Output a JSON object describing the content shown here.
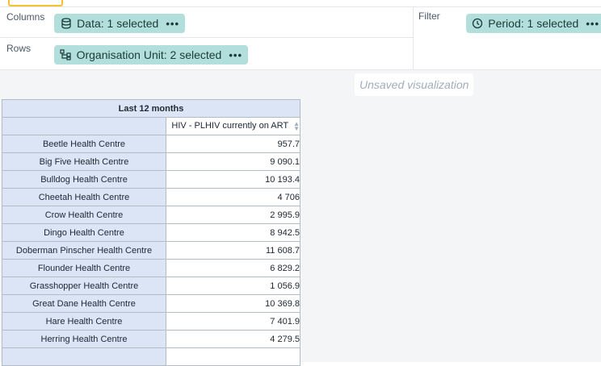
{
  "layout": {
    "columns_label": "Columns",
    "rows_label": "Rows",
    "filter_label": "Filter",
    "columns_chip": "Data: 1 selected",
    "rows_chip": "Organisation Unit: 2 selected",
    "filter_chip": "Period: 1 selected",
    "more": "•••"
  },
  "canvas": {
    "status": "Unsaved visualization"
  },
  "table": {
    "period_header": "Last 12 months",
    "data_header": "HIV - PLHIV currently on ART",
    "rows": [
      {
        "org_unit": "Beetle Health Centre",
        "value": "957.7"
      },
      {
        "org_unit": "Big Five Health Centre",
        "value": "9 090.1"
      },
      {
        "org_unit": "Bulldog Health Centre",
        "value": "10 193.4"
      },
      {
        "org_unit": "Cheetah Health Centre",
        "value": "4 706"
      },
      {
        "org_unit": "Crow Health Centre",
        "value": "2 995.9"
      },
      {
        "org_unit": "Dingo Health Centre",
        "value": "8 942.5"
      },
      {
        "org_unit": "Doberman Pinscher Health Centre",
        "value": "11 608.7"
      },
      {
        "org_unit": "Flounder Health Centre",
        "value": "6 829.2"
      },
      {
        "org_unit": "Grasshopper Health Centre",
        "value": "1 056.9"
      },
      {
        "org_unit": "Great Dane Health Centre",
        "value": "10 369.8"
      },
      {
        "org_unit": "Hare Health Centre",
        "value": "7 401.9"
      },
      {
        "org_unit": "Herring Health Centre",
        "value": "4 279.5"
      },
      {
        "org_unit": "",
        "value": ""
      }
    ]
  },
  "colors": {
    "chip": "#b2dfdb",
    "header": "#dbe5f6",
    "accent": "#f2c230"
  }
}
